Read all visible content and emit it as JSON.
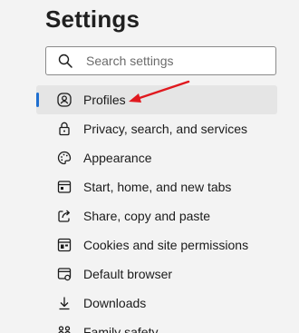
{
  "header": {
    "title": "Settings"
  },
  "search": {
    "placeholder": "Search settings",
    "value": ""
  },
  "nav": {
    "items": [
      {
        "label": "Profiles",
        "icon": "profile-icon",
        "active": true
      },
      {
        "label": "Privacy, search, and services",
        "icon": "lock-icon"
      },
      {
        "label": "Appearance",
        "icon": "palette-icon"
      },
      {
        "label": "Start, home, and new tabs",
        "icon": "start-home-icon"
      },
      {
        "label": "Share, copy and paste",
        "icon": "share-icon"
      },
      {
        "label": "Cookies and site permissions",
        "icon": "cookies-icon"
      },
      {
        "label": "Default browser",
        "icon": "default-browser-icon"
      },
      {
        "label": "Downloads",
        "icon": "download-icon"
      },
      {
        "label": "Family safety",
        "icon": "family-icon"
      }
    ]
  },
  "annotation": {
    "arrow_color": "#e0191f",
    "accent": "#1f6fd0"
  }
}
